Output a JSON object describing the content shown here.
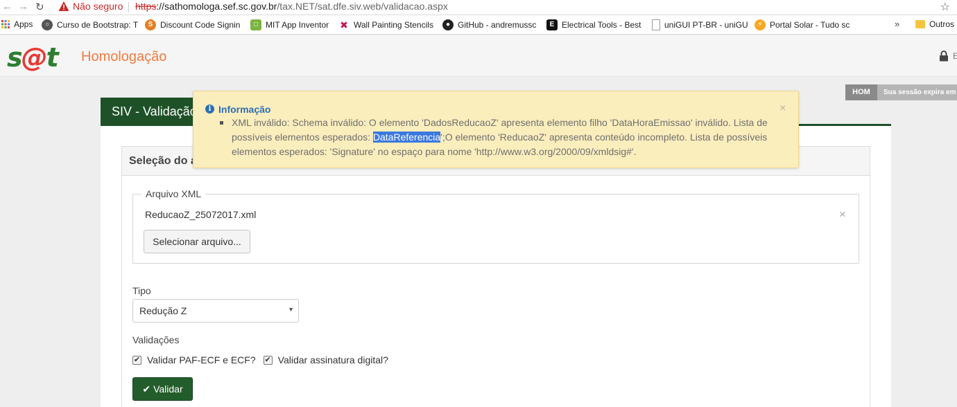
{
  "browser": {
    "security_label": "Não seguro",
    "url_scheme": "https",
    "url_host": "://sathomologa.sef.sc.gov.br",
    "url_path": "/tax.NET/sat.dfe.siv.web/validacao.aspx",
    "bookmarks": [
      {
        "label": "Apps",
        "color": "#4285f4"
      },
      {
        "label": "Curso de Bootstrap: T",
        "color": "#555555"
      },
      {
        "label": "Discount Code Signin",
        "color": "#e67e22"
      },
      {
        "label": "MIT App Inventor",
        "color": "#7cb342"
      },
      {
        "label": "Wall Painting Stencils",
        "color": "#c2185b"
      },
      {
        "label": "GitHub - andremussc",
        "color": "#222222"
      },
      {
        "label": "Electrical Tools - Best",
        "color": "#111111"
      },
      {
        "label": "uniGUI PT-BR - uniGU",
        "color": "#9e9e9e"
      },
      {
        "label": "Portal Solar - Tudo sc",
        "color": "#f9a825"
      }
    ],
    "more_label": "»",
    "other_bookmarks": "Outros"
  },
  "header": {
    "logo_prefix": "s",
    "logo_at": "@",
    "logo_suffix": "t",
    "environment": "Homologação",
    "user_initial": "E"
  },
  "session": {
    "badge": "HOM",
    "text": "Sua sessão expira em"
  },
  "page": {
    "title": "SIV - Validação",
    "panel_title": "Seleção do a"
  },
  "form": {
    "xml_legend": "Arquivo XML",
    "file_name": "ReducaoZ_25072017.xml",
    "remove_glyph": "×",
    "select_file_label": "Selecionar arquivo...",
    "tipo_label": "Tipo",
    "tipo_value": "Redução Z",
    "validacoes_label": "Validações",
    "check_paf": "Validar PAF-ECF e ECF?",
    "check_assinatura": "Validar assinatura digital?",
    "validar_label": "Validar"
  },
  "alert": {
    "title": "Informação",
    "close_glyph": "×",
    "msg_part1": "XML inválido: Schema inválido: O elemento 'DadosReducaoZ' apresenta elemento filho 'DataHoraEmissao' inválido. Lista de possíveis elementos esperados: ",
    "msg_highlight": "DataReferencia",
    "msg_part2": "';O elemento 'ReducaoZ' apresenta conteúdo incompleto. Lista de possíveis elementos esperados: 'Signature' no espaço para nome 'http://www.w3.org/2000/09/xmldsig#'."
  },
  "colors": {
    "brand_green": "#1e5128",
    "logo_green": "#2e7d32",
    "logo_red": "#e53935",
    "env_orange": "#f07b3f",
    "alert_bg": "#fbeebd",
    "alert_title": "#2a6fb5"
  }
}
